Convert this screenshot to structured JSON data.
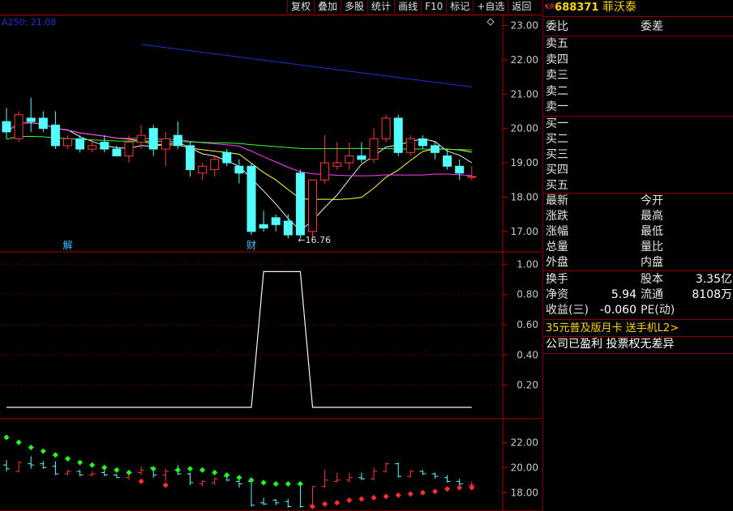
{
  "toolbar": [
    "复权",
    "叠加",
    "多股",
    "统计",
    "画线",
    "F10",
    "标记",
    "+自选",
    "返回"
  ],
  "stock": {
    "market_tag": "KR",
    "code": "688371",
    "name": "菲沃泰"
  },
  "ma_label": "A250: 21.08",
  "low_annotation": "16.76",
  "event_markers": [
    {
      "text": "解",
      "index": 5
    },
    {
      "text": "财",
      "index": 20
    }
  ],
  "main_axis": {
    "ticks": [
      "23.00",
      "22.00",
      "21.00",
      "20.00",
      "19.00",
      "18.00",
      "17.00"
    ],
    "ylim": [
      16.5,
      23.2
    ]
  },
  "indicator_axis": {
    "ticks": [
      "1.00",
      "0.80",
      "0.60",
      "0.40",
      "0.20"
    ],
    "ylim": [
      0,
      1.05
    ]
  },
  "lower_axis": {
    "ticks": [
      "22.00",
      "20.00",
      "18.00"
    ],
    "ylim": [
      16.8,
      23.5
    ]
  },
  "chart_data": {
    "type": "candlestick",
    "candles": [
      {
        "o": 20.2,
        "h": 20.6,
        "l": 19.7,
        "c": 19.9
      },
      {
        "o": 19.7,
        "h": 20.5,
        "l": 19.6,
        "c": 20.4
      },
      {
        "o": 20.3,
        "h": 20.9,
        "l": 19.9,
        "c": 20.2
      },
      {
        "o": 20.3,
        "h": 20.5,
        "l": 19.9,
        "c": 20.0
      },
      {
        "o": 20.1,
        "h": 20.5,
        "l": 19.4,
        "c": 19.5
      },
      {
        "o": 19.5,
        "h": 19.8,
        "l": 19.4,
        "c": 19.7
      },
      {
        "o": 19.7,
        "h": 19.8,
        "l": 19.3,
        "c": 19.4
      },
      {
        "o": 19.4,
        "h": 19.7,
        "l": 19.3,
        "c": 19.5
      },
      {
        "o": 19.6,
        "h": 19.8,
        "l": 19.3,
        "c": 19.4
      },
      {
        "o": 19.4,
        "h": 19.5,
        "l": 19.2,
        "c": 19.2
      },
      {
        "o": 19.2,
        "h": 19.8,
        "l": 19.0,
        "c": 19.6
      },
      {
        "o": 19.6,
        "h": 20.1,
        "l": 19.4,
        "c": 19.8
      },
      {
        "o": 20.0,
        "h": 20.1,
        "l": 19.2,
        "c": 19.4
      },
      {
        "o": 19.4,
        "h": 19.9,
        "l": 18.9,
        "c": 19.7
      },
      {
        "o": 19.8,
        "h": 20.2,
        "l": 19.4,
        "c": 19.5
      },
      {
        "o": 19.5,
        "h": 19.6,
        "l": 18.6,
        "c": 18.8
      },
      {
        "o": 18.7,
        "h": 19.0,
        "l": 18.5,
        "c": 18.9
      },
      {
        "o": 18.8,
        "h": 19.2,
        "l": 18.6,
        "c": 19.1
      },
      {
        "o": 19.3,
        "h": 19.4,
        "l": 18.9,
        "c": 19.0
      },
      {
        "o": 18.9,
        "h": 19.1,
        "l": 18.4,
        "c": 18.7
      },
      {
        "o": 18.9,
        "h": 19.0,
        "l": 16.9,
        "c": 17.0
      },
      {
        "o": 17.2,
        "h": 17.6,
        "l": 17.0,
        "c": 17.1
      },
      {
        "o": 17.4,
        "h": 17.5,
        "l": 17.0,
        "c": 17.2
      },
      {
        "o": 17.3,
        "h": 17.5,
        "l": 16.8,
        "c": 16.9
      },
      {
        "o": 18.7,
        "h": 18.8,
        "l": 16.8,
        "c": 16.9
      },
      {
        "o": 17.0,
        "h": 18.5,
        "l": 16.8,
        "c": 18.5
      },
      {
        "o": 18.5,
        "h": 19.8,
        "l": 18.4,
        "c": 19.0
      },
      {
        "o": 18.9,
        "h": 19.6,
        "l": 18.8,
        "c": 19.0
      },
      {
        "o": 19.0,
        "h": 19.6,
        "l": 18.8,
        "c": 19.2
      },
      {
        "o": 19.2,
        "h": 19.6,
        "l": 19.0,
        "c": 19.1
      },
      {
        "o": 19.1,
        "h": 20.0,
        "l": 19.0,
        "c": 19.7
      },
      {
        "o": 19.7,
        "h": 20.4,
        "l": 19.6,
        "c": 20.3
      },
      {
        "o": 20.3,
        "h": 20.4,
        "l": 19.2,
        "c": 19.3
      },
      {
        "o": 19.3,
        "h": 19.8,
        "l": 19.2,
        "c": 19.7
      },
      {
        "o": 19.7,
        "h": 19.8,
        "l": 19.4,
        "c": 19.5
      },
      {
        "o": 19.5,
        "h": 19.6,
        "l": 19.1,
        "c": 19.3
      },
      {
        "o": 19.2,
        "h": 19.4,
        "l": 18.8,
        "c": 18.9
      },
      {
        "o": 18.9,
        "h": 19.1,
        "l": 18.5,
        "c": 18.7
      },
      {
        "o": 18.6,
        "h": 18.9,
        "l": 18.5,
        "c": 18.6
      }
    ],
    "indicator": [
      0,
      0,
      0,
      0,
      0,
      0,
      0,
      0,
      0,
      0,
      0,
      0,
      0,
      0,
      0,
      0,
      0,
      0,
      0,
      0,
      0,
      1,
      1,
      1,
      1,
      0,
      0,
      0,
      0,
      0,
      0,
      0,
      0,
      0,
      0,
      0,
      0,
      0,
      0
    ],
    "lower_dots": [
      {
        "v": 22.4,
        "c": "g"
      },
      {
        "v": 22.0,
        "c": "g"
      },
      {
        "v": 21.6,
        "c": "g"
      },
      {
        "v": 21.3,
        "c": "g"
      },
      {
        "v": 21.0,
        "c": "g"
      },
      {
        "v": 20.7,
        "c": "g"
      },
      {
        "v": 20.4,
        "c": "g"
      },
      {
        "v": 20.2,
        "c": "g"
      },
      {
        "v": 20.0,
        "c": "g"
      },
      {
        "v": 19.8,
        "c": "g"
      },
      {
        "v": 19.6,
        "c": "g"
      },
      {
        "v": 18.9,
        "c": "r"
      },
      {
        "v": 19.9,
        "c": "g"
      },
      {
        "v": 18.6,
        "c": "r"
      },
      {
        "v": 19.8,
        "c": "g"
      },
      {
        "v": 19.9,
        "c": "g"
      },
      {
        "v": 19.8,
        "c": "g"
      },
      {
        "v": 19.6,
        "c": "g"
      },
      {
        "v": 19.4,
        "c": "g"
      },
      {
        "v": 19.2,
        "c": "g"
      },
      {
        "v": 19.0,
        "c": "g"
      },
      {
        "v": 18.8,
        "c": "g"
      },
      {
        "v": 18.7,
        "c": "g"
      },
      {
        "v": 18.7,
        "c": "g"
      },
      {
        "v": 18.7,
        "c": "g"
      },
      {
        "v": 16.9,
        "c": "r"
      },
      {
        "v": 17.1,
        "c": "r"
      },
      {
        "v": 17.2,
        "c": "r"
      },
      {
        "v": 17.4,
        "c": "r"
      },
      {
        "v": 17.5,
        "c": "r"
      },
      {
        "v": 17.6,
        "c": "r"
      },
      {
        "v": 17.7,
        "c": "r"
      },
      {
        "v": 17.8,
        "c": "r"
      },
      {
        "v": 17.9,
        "c": "r"
      },
      {
        "v": 18.0,
        "c": "r"
      },
      {
        "v": 18.1,
        "c": "r"
      },
      {
        "v": 18.3,
        "c": "r"
      },
      {
        "v": 18.4,
        "c": "r"
      },
      {
        "v": 18.4,
        "c": "r"
      }
    ]
  },
  "panel": {
    "header": {
      "left": "委比",
      "right": "委差"
    },
    "sell": [
      "卖五",
      "卖四",
      "卖三",
      "卖二",
      "卖一"
    ],
    "buy": [
      "买一",
      "买二",
      "买三",
      "买四",
      "买五"
    ],
    "stats": [
      [
        "最新",
        "今开"
      ],
      [
        "涨跌",
        "最高"
      ],
      [
        "涨幅",
        "最低"
      ],
      [
        "总量",
        "量比"
      ],
      [
        "外盘",
        "内盘"
      ]
    ],
    "fund": [
      {
        "l1": "换手",
        "v1": "",
        "l2": "股本",
        "v2": "3.35亿"
      },
      {
        "l1": "净资",
        "v1": "5.94",
        "l2": "流通",
        "v2": "8108万"
      },
      {
        "l1": "收益(三)",
        "v1": "-0.060",
        "l2": "PE(动)",
        "v2": ""
      }
    ],
    "promo": "35元普及版月卡 送手机L2>",
    "notice": "公司已盈利 投票权无差异"
  },
  "colors": {
    "up": "#ff3a3a",
    "down": "#54ffff",
    "frame": "#b00000",
    "ma250": "#2030d0"
  }
}
